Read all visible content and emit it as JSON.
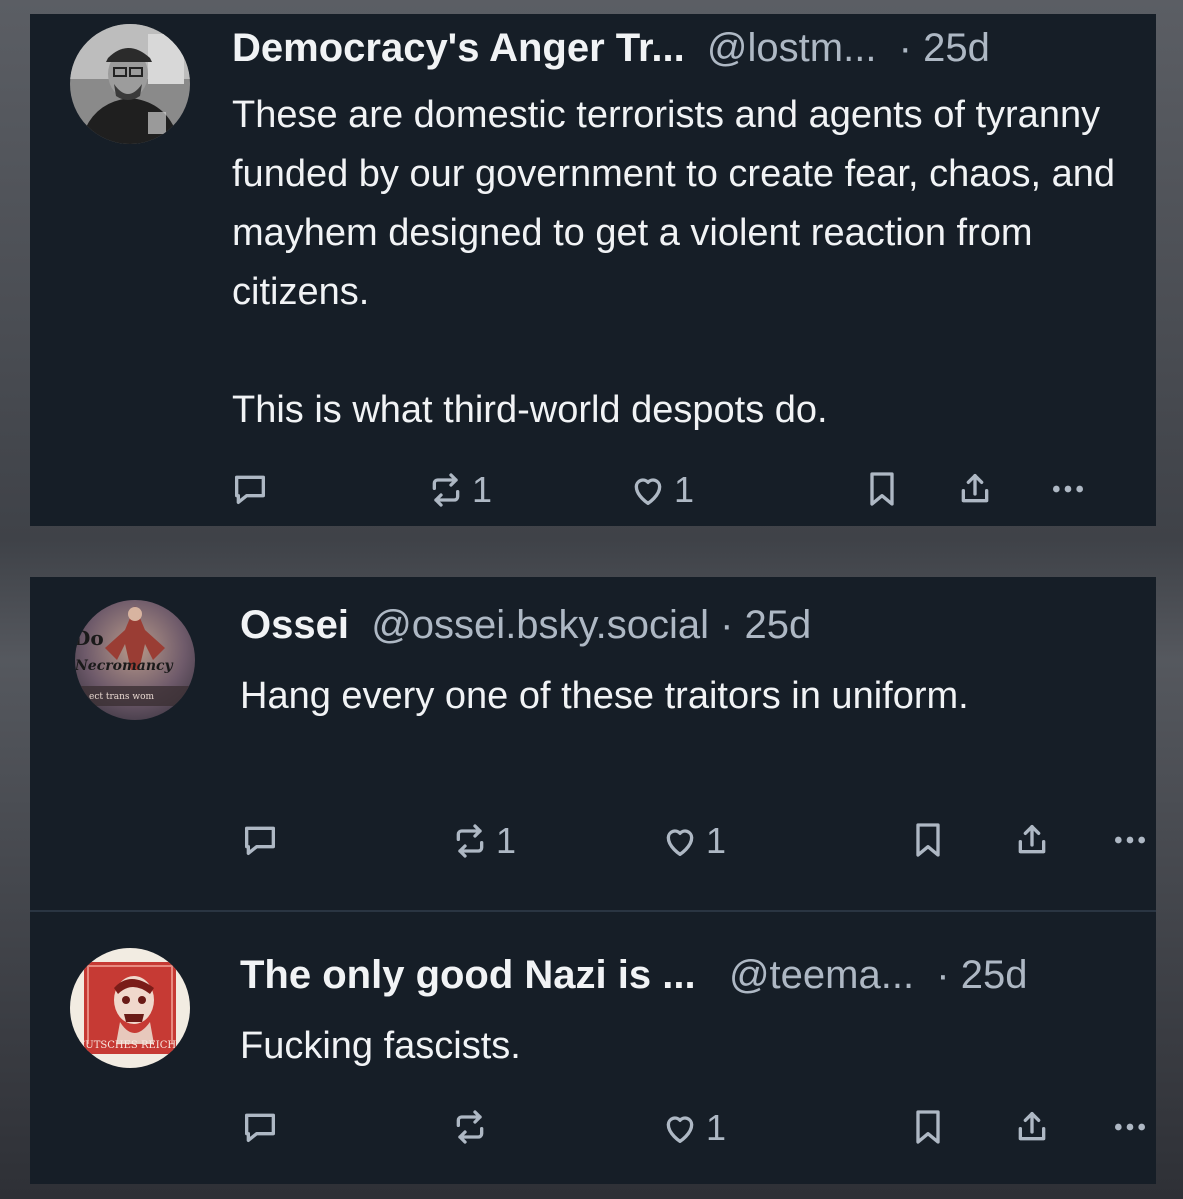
{
  "posts": [
    {
      "display_name": "Democracy's Anger Tr...",
      "handle": "@lostm...",
      "separator": "·",
      "time": "25d",
      "text": "These are domestic terrorists and agents of tyranny funded by our government to create fear, chaos, and mayhem designed to get a violent reaction from citizens.\n\nThis is what third-world despots do.",
      "reposts": "1",
      "likes": "1"
    },
    {
      "display_name": "Ossei",
      "handle": "@ossei.bsky.social",
      "separator": "·",
      "time": "25d",
      "text": "Hang every one of these traitors in uniform.",
      "avatar_text": {
        "line1": "Do",
        "line2": "Necromancy",
        "line3": "ect trans wom"
      },
      "reposts": "1",
      "likes": "1"
    },
    {
      "display_name": "The only good Nazi is ...",
      "handle": "@teema...",
      "separator": "·",
      "time": "25d",
      "text": "Fucking fascists.",
      "avatar_text": {
        "line1": "EUTSCHES REICH"
      },
      "reposts": "",
      "likes": "1"
    }
  ],
  "icons": [
    "reply-icon",
    "repost-icon",
    "like-icon",
    "bookmark-icon",
    "share-icon",
    "more-icon"
  ],
  "colors": {
    "card_bg": "#161e27",
    "text": "#f1f3f5",
    "muted": "#aeb8c4",
    "divider": "#2a3542"
  }
}
